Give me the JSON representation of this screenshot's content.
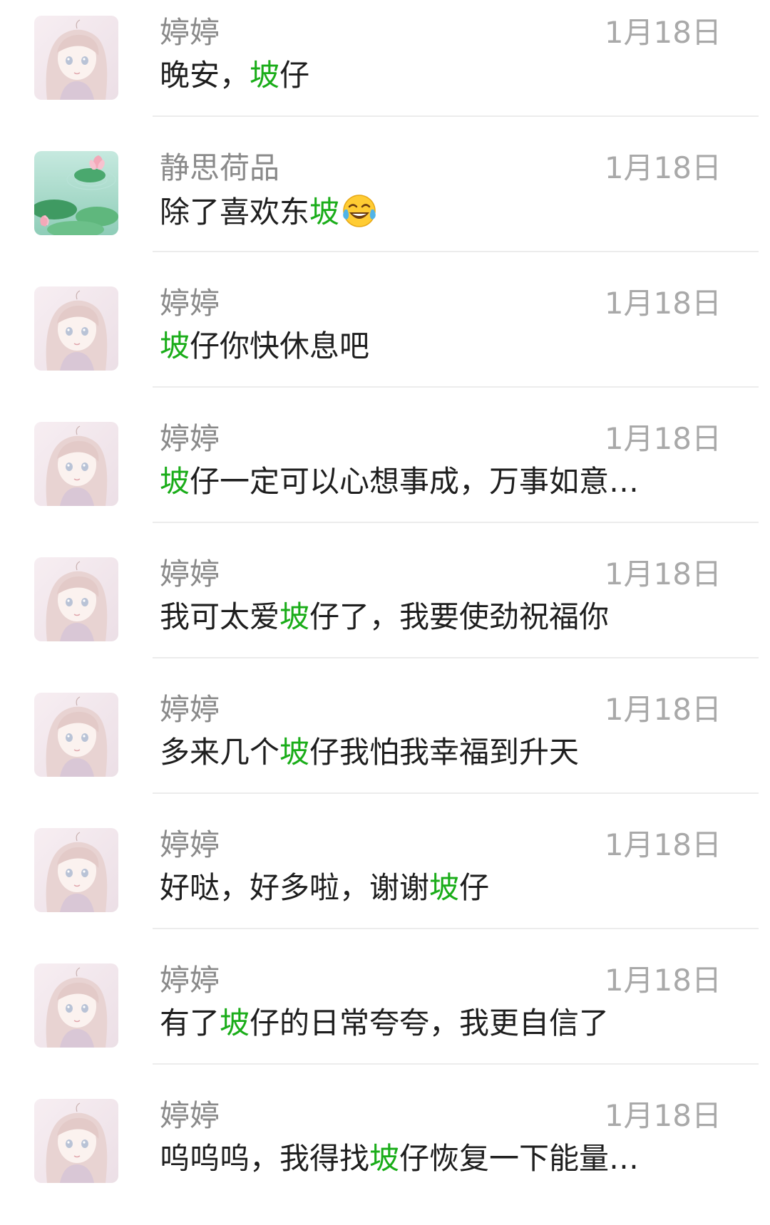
{
  "highlight_color": "#1aad19",
  "conversations": [
    {
      "avatar": "girl-avatar",
      "name": "婷婷",
      "time": "1月18日",
      "pre": "晚安，",
      "hl": "坡",
      "post": "仔",
      "emoji": ""
    },
    {
      "avatar": "lotus-avatar",
      "name": "静思荷品",
      "time": "1月18日",
      "pre": "除了喜欢东",
      "hl": "坡",
      "post": "",
      "emoji": "tears-of-joy-emoji"
    },
    {
      "avatar": "girl-avatar",
      "name": "婷婷",
      "time": "1月18日",
      "pre": "",
      "hl": "坡",
      "post": "仔你快休息吧",
      "emoji": ""
    },
    {
      "avatar": "girl-avatar",
      "name": "婷婷",
      "time": "1月18日",
      "pre": "",
      "hl": "坡",
      "post": "仔一定可以心想事成，万事如意…",
      "emoji": ""
    },
    {
      "avatar": "girl-avatar",
      "name": "婷婷",
      "time": "1月18日",
      "pre": "我可太爱",
      "hl": "坡",
      "post": "仔了，我要使劲祝福你",
      "emoji": ""
    },
    {
      "avatar": "girl-avatar",
      "name": "婷婷",
      "time": "1月18日",
      "pre": "多来几个",
      "hl": "坡",
      "post": "仔我怕我幸福到升天",
      "emoji": ""
    },
    {
      "avatar": "girl-avatar",
      "name": "婷婷",
      "time": "1月18日",
      "pre": "好哒，好多啦，谢谢",
      "hl": "坡",
      "post": "仔",
      "emoji": ""
    },
    {
      "avatar": "girl-avatar",
      "name": "婷婷",
      "time": "1月18日",
      "pre": "有了",
      "hl": "坡",
      "post": "仔的日常夸夸，我更自信了",
      "emoji": ""
    },
    {
      "avatar": "girl-avatar",
      "name": "婷婷",
      "time": "1月18日",
      "pre": "呜呜呜，我得找",
      "hl": "坡",
      "post": "仔恢复一下能量…",
      "emoji": ""
    }
  ]
}
